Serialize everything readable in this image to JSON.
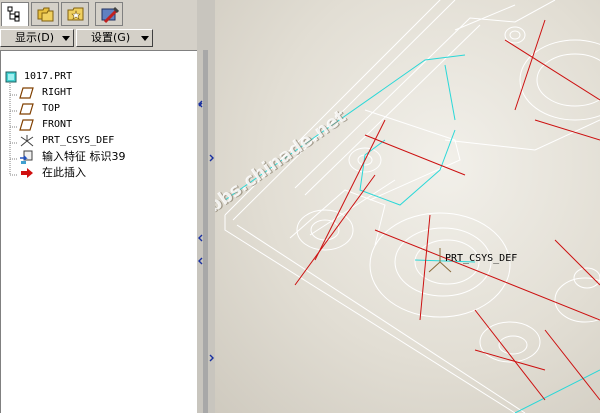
{
  "toolbar": {
    "tabs": [
      {
        "icon": "model-tree-icon"
      },
      {
        "icon": "folder-browser-icon"
      },
      {
        "icon": "favorites-icon"
      },
      {
        "icon": "tools-icon"
      }
    ],
    "display_label": "显示(D)",
    "settings_label": "设置(G)"
  },
  "tree": {
    "items": [
      {
        "label": "1017.PRT",
        "icon": "part-icon"
      },
      {
        "label": "RIGHT",
        "icon": "datum-plane-icon"
      },
      {
        "label": "TOP",
        "icon": "datum-plane-icon"
      },
      {
        "label": "FRONT",
        "icon": "datum-plane-icon"
      },
      {
        "label": "PRT_CSYS_DEF",
        "icon": "csys-icon"
      },
      {
        "label": "输入特征 标识39",
        "icon": "import-feature-icon"
      },
      {
        "label": "在此插入",
        "icon": "insert-here-icon"
      }
    ]
  },
  "viewport": {
    "csys_label": "PRT_CSYS_DEF",
    "watermark": "bbs.chinade.net"
  },
  "colors": {
    "model_lines": "#ffffff",
    "datum_lines": "#cc1010",
    "cyan_lines": "#2ad8d8"
  }
}
